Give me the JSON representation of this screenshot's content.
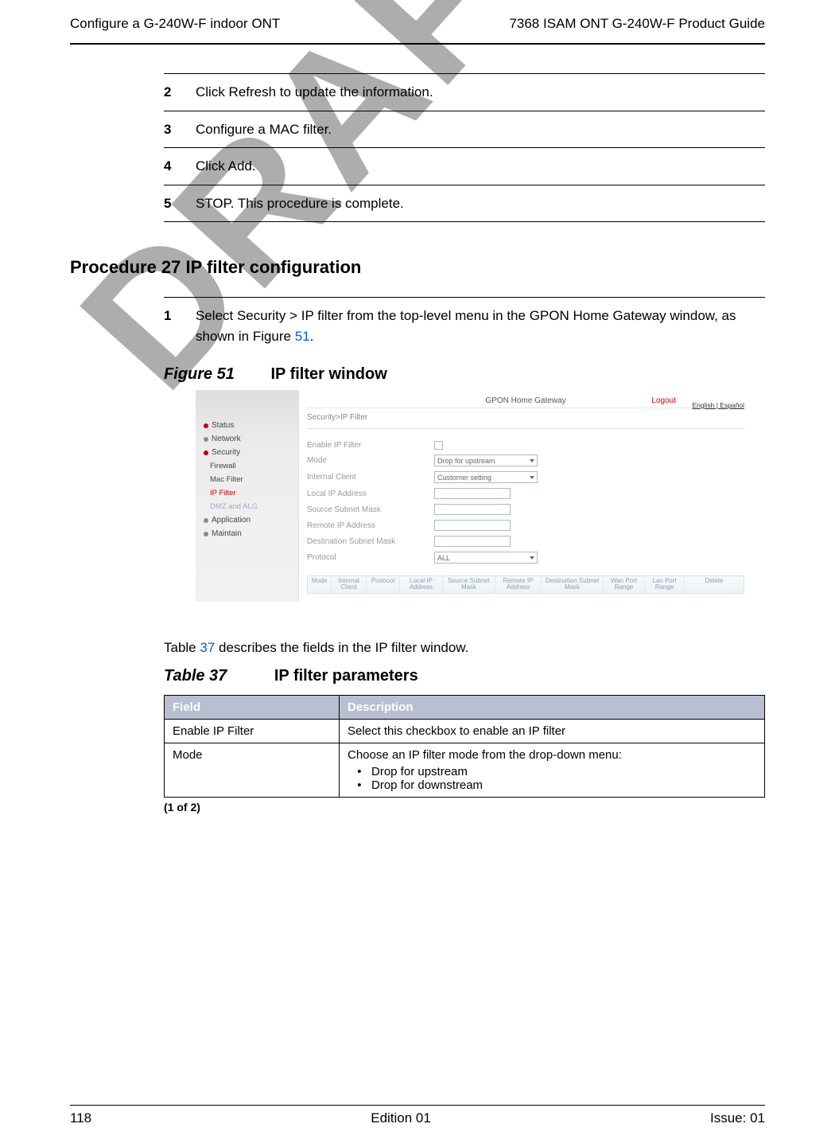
{
  "header": {
    "left": "Configure a G-240W-F indoor ONT",
    "right": "7368 ISAM ONT G-240W-F Product Guide"
  },
  "watermark": "DRAFT",
  "steps": {
    "s2_num": "2",
    "s2": "Click Refresh to update the information.",
    "s3_num": "3",
    "s3": "Configure a MAC filter.",
    "s4_num": "4",
    "s4": "Click Add.",
    "s5_num": "5",
    "s5": "STOP. This procedure is complete."
  },
  "procedure": {
    "heading": "Procedure 27     IP filter configuration",
    "step1_num": "1",
    "step1_a": "Select Security > IP filter from the top-level menu in the GPON Home Gateway window, as shown in Figure ",
    "step1_link": "51",
    "step1_b": "."
  },
  "figure": {
    "caption_prefix": "Figure 51",
    "caption_title": "IP filter window"
  },
  "screenshot": {
    "title": "GPON Home Gateway",
    "logout": "Logout",
    "lang_en": "English",
    "lang_es": "Español",
    "breadcrumb": "Security>IP Filter",
    "sidebar": {
      "status": "Status",
      "network": "Network",
      "security": "Security",
      "firewall": "Firewall",
      "mac_filter": "Mac Filter",
      "ip_filter": "IP Filter",
      "dmz_alg": "DMZ and ALG",
      "application": "Application",
      "maintain": "Maintain"
    },
    "fields": {
      "enable_label": "Enable IP Filter",
      "mode_label": "Mode",
      "mode_value": "Drop for upstream",
      "internal_client_label": "Internal Client",
      "internal_client_value": "Customer setting",
      "local_ip_label": "Local IP Address",
      "src_mask_label": "Source Subnet Mask",
      "remote_ip_label": "Remote IP Address",
      "dst_mask_label": "Destination Subnet Mask",
      "protocol_label": "Protocol",
      "protocol_value": "ALL"
    },
    "headers": {
      "h1": "Mode",
      "h2": "Internal Client",
      "h3": "Protocol",
      "h4": "Local IP Address",
      "h5": "Source Subnet Mask",
      "h6": "Remote IP Address",
      "h7": "Destination Subnet Mask",
      "h8": "Wan Port Range",
      "h9": "Lan Port Range",
      "h10": "Delete"
    }
  },
  "body_text_a": "Table ",
  "body_text_link": "37",
  "body_text_b": " describes the fields in the IP filter window.",
  "table": {
    "caption_prefix": "Table 37",
    "caption_title": "IP filter parameters",
    "th1": "Field",
    "th2": "Description",
    "r1c1": "Enable IP Filter",
    "r1c2": "Select this checkbox to enable an IP filter",
    "r2c1": "Mode",
    "r2c2_head": "Choose an IP filter mode from the drop-down menu:",
    "r2c2_li1": "Drop for upstream",
    "r2c2_li2": "Drop for downstream",
    "pager": "(1 of 2)"
  },
  "footer": {
    "left": "118",
    "center": "Edition 01",
    "right": "Issue: 01"
  }
}
